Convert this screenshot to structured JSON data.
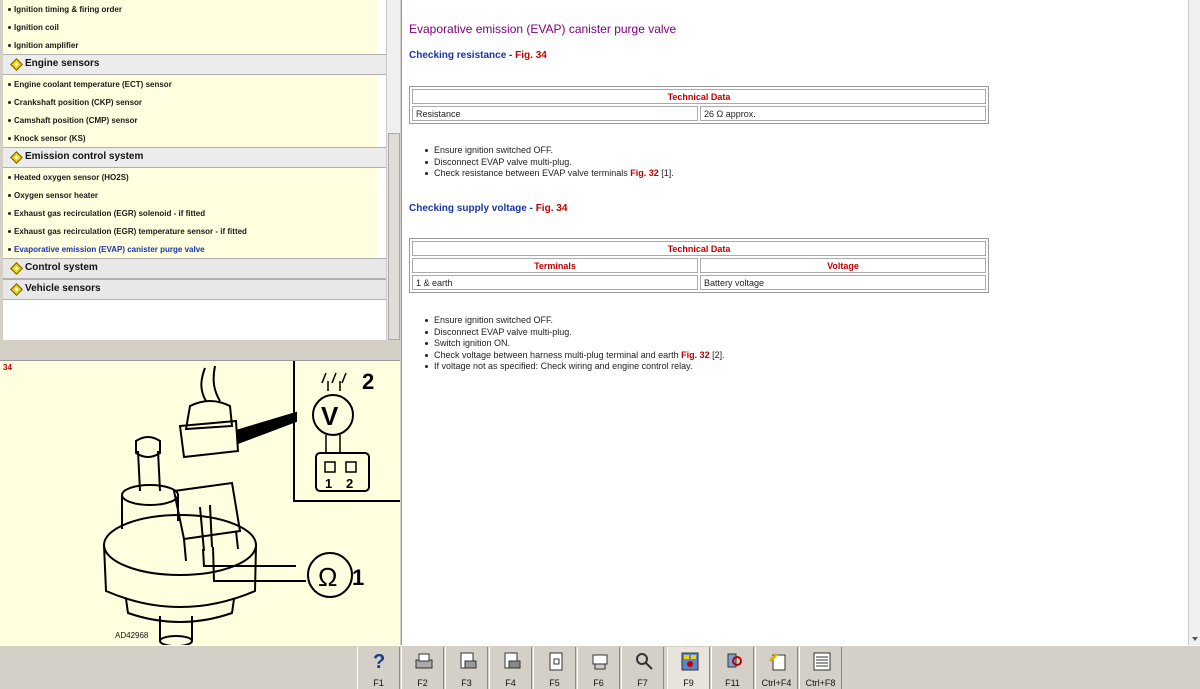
{
  "nav_tree": {
    "group_top_items": [
      "Ignition timing & firing order",
      "Ignition coil",
      "Ignition amplifier"
    ],
    "categories": [
      {
        "label": "Engine sensors",
        "items": [
          "Engine coolant temperature (ECT) sensor",
          "Crankshaft position (CKP) sensor",
          "Camshaft position (CMP) sensor",
          "Knock sensor (KS)"
        ]
      },
      {
        "label": "Emission control system",
        "items": [
          "Heated oxygen sensor (HO2S)",
          "Oxygen sensor heater",
          "Exhaust gas recirculation (EGR) solenoid - if fitted",
          "Exhaust gas recirculation (EGR) temperature sensor - if fitted",
          "Evaporative emission (EVAP) canister purge valve"
        ]
      },
      {
        "label": "Control system"
      },
      {
        "label": "Vehicle sensors"
      }
    ],
    "active_item": "Evaporative emission (EVAP) canister purge valve"
  },
  "figure": {
    "number": "34",
    "code": "AD42968",
    "callout_1": "1",
    "callout_2": "2",
    "meter_v": "V",
    "meter_ohm": "Ω",
    "pin_1": "1",
    "pin_2": "2"
  },
  "content": {
    "title": "Evaporative emission (EVAP) canister purge valve",
    "section1": {
      "label": "Checking resistance",
      "sep": " - ",
      "fig": "Fig. 34"
    },
    "table1": {
      "header": "Technical Data",
      "rows": [
        [
          "Resistance",
          "26 Ω approx."
        ]
      ]
    },
    "steps1": [
      {
        "text": "Ensure ignition switched OFF."
      },
      {
        "text": "Disconnect EVAP valve multi-plug."
      },
      {
        "text": "Check resistance between EVAP valve terminals ",
        "fig": "Fig. 32",
        "after": " [1]."
      }
    ],
    "section2": {
      "label": "Checking supply voltage",
      "sep": " - ",
      "fig": "Fig. 34"
    },
    "table2": {
      "header": "Technical Data",
      "col1": "Terminals",
      "col2": "Voltage",
      "rows": [
        [
          "1 & earth",
          "Battery voltage"
        ]
      ]
    },
    "steps2": [
      {
        "text": "Ensure ignition switched OFF."
      },
      {
        "text": "Disconnect EVAP valve multi-plug."
      },
      {
        "text": "Switch ignition ON."
      },
      {
        "text": "Check voltage between harness multi-plug terminal and earth ",
        "fig": "Fig. 32",
        "after": " [2]."
      },
      {
        "text": "If voltage not as specified: Check wiring and engine control relay."
      }
    ]
  },
  "toolbar": {
    "buttons": [
      {
        "label": "F1",
        "icon": "help-icon"
      },
      {
        "label": "F2",
        "icon": "printer-icon"
      },
      {
        "label": "F3",
        "icon": "print-page-icon"
      },
      {
        "label": "F4",
        "icon": "print-doc-icon"
      },
      {
        "label": "F5",
        "icon": "page-icon"
      },
      {
        "label": "F6",
        "icon": "connector-icon"
      },
      {
        "label": "F7",
        "icon": "magnifier-icon"
      },
      {
        "label": "F9",
        "icon": "diagram-icon"
      },
      {
        "label": "F11",
        "icon": "search-vehicle-icon"
      },
      {
        "label": "Ctrl+F4",
        "icon": "edit-note-icon"
      },
      {
        "label": "Ctrl+F8",
        "icon": "list-icon"
      }
    ]
  }
}
